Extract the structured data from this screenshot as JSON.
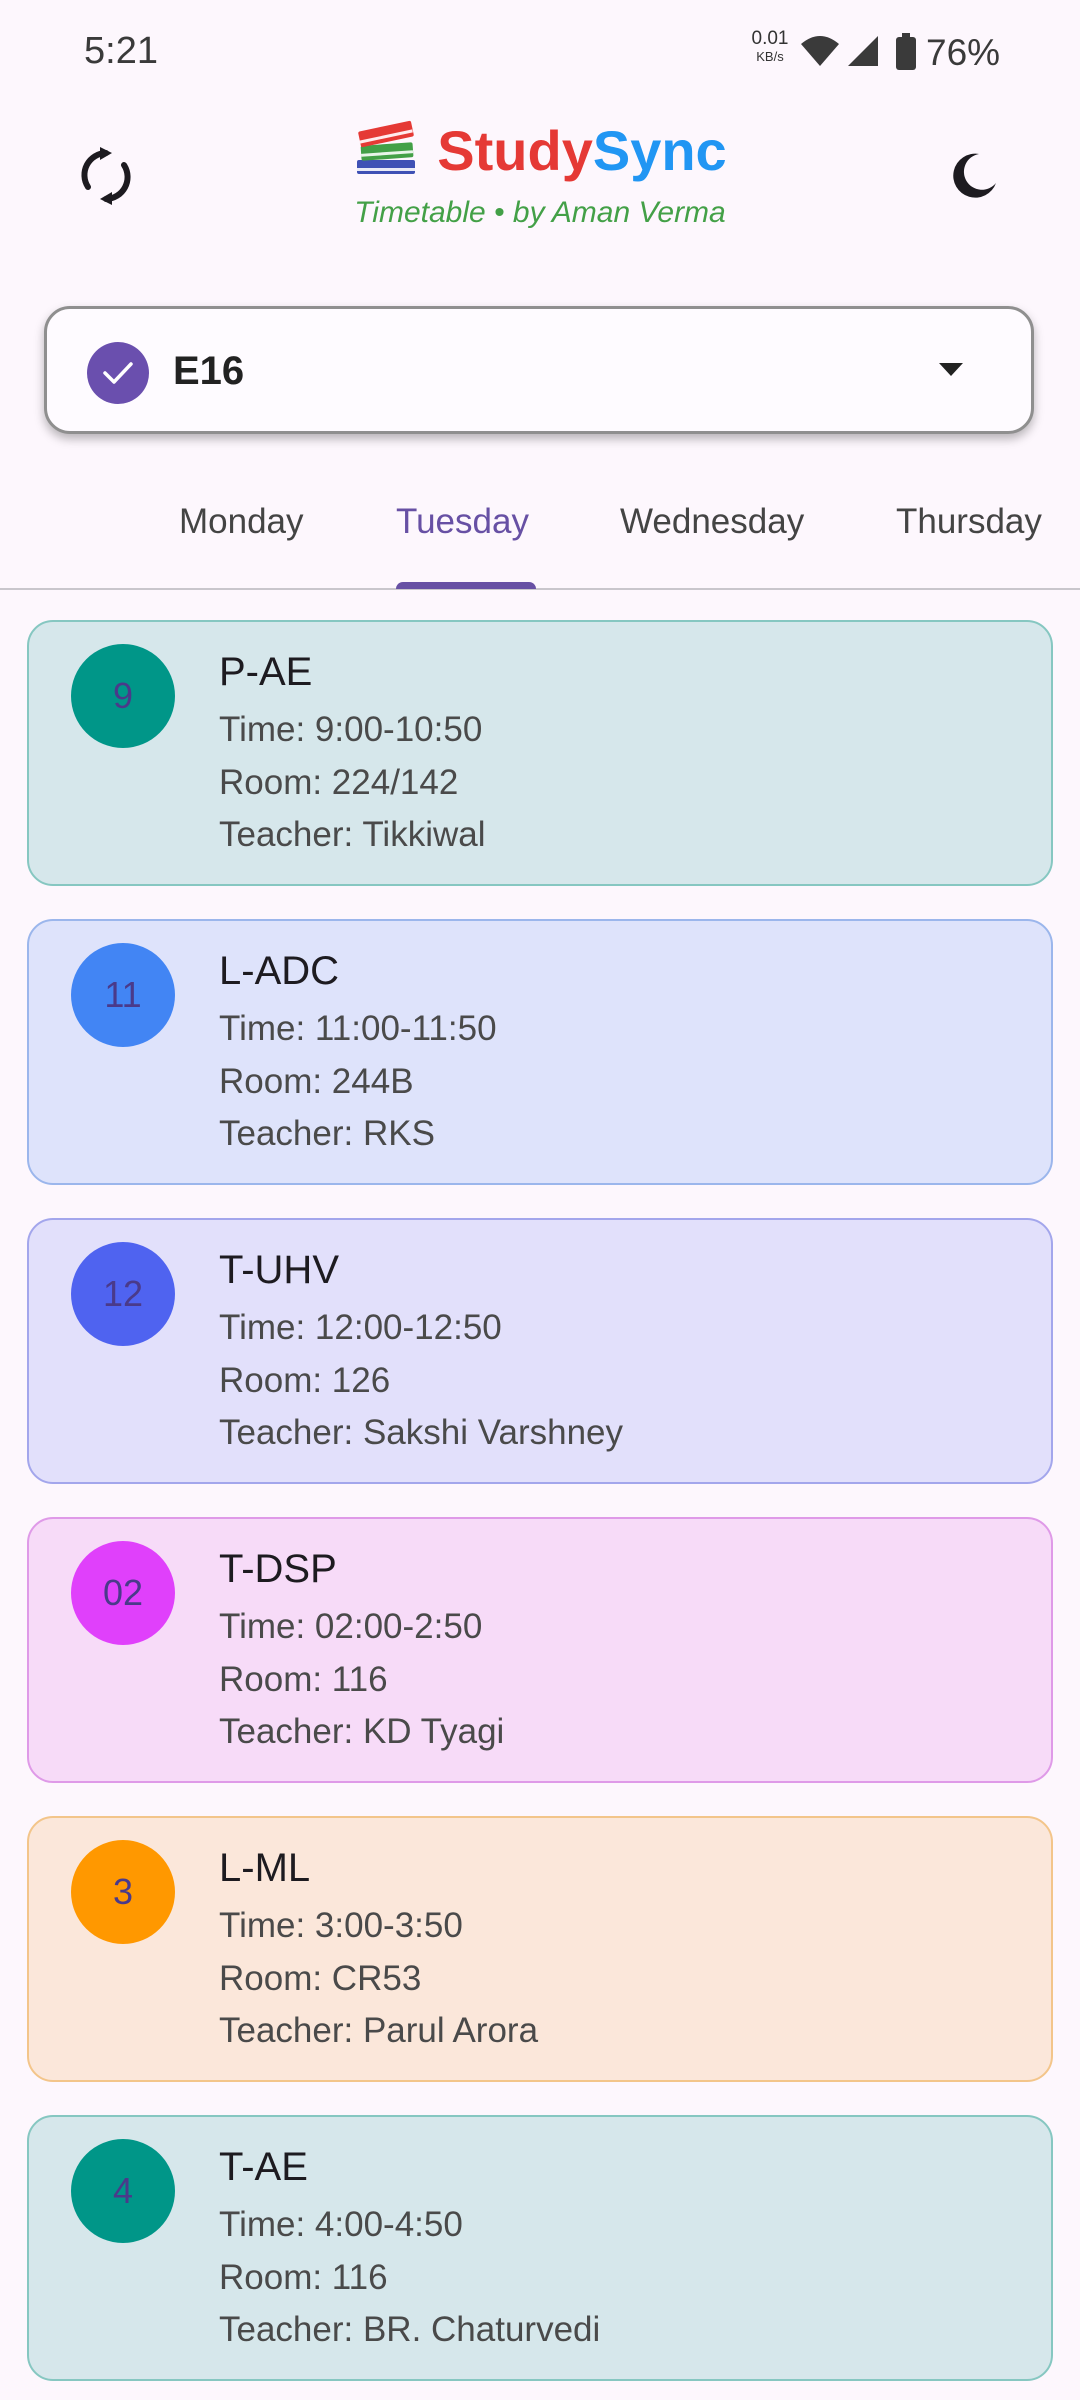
{
  "status_bar": {
    "time": "5:21",
    "net_speed_value": "0.01",
    "net_speed_unit": "KB/s",
    "battery": "76%",
    "icons": [
      "wifi-icon",
      "signal-icon",
      "battery-icon"
    ]
  },
  "header": {
    "brand_part1": "StudySync",
    "brand_study": "Study",
    "brand_sync": "Sync",
    "subtitle": "Timetable • by Aman Verma",
    "left_icon": "sync-icon",
    "right_icon": "moon-icon",
    "colors": {
      "study": "#e53935",
      "sync": "#2196f3",
      "subtitle": "#43a047"
    }
  },
  "group_select": {
    "value": "E16",
    "icon": "check-icon"
  },
  "tabs": {
    "items": [
      "Monday",
      "Tuesday",
      "Wednesday",
      "Thursday"
    ],
    "active": "Tuesday",
    "accent": "#6750a4"
  },
  "classes": [
    {
      "slot": "9",
      "subject": "P-AE",
      "time": "Time: 9:00-10:50",
      "room": "Room: 224/142",
      "teacher": "Teacher: Tikkiwal",
      "bg": "#d6e7eb",
      "border": "#86c7c1",
      "circle": "#009688"
    },
    {
      "slot": "11",
      "subject": "L-ADC",
      "time": "Time: 11:00-11:50",
      "room": "Room: 244B",
      "teacher": "Teacher: RKS",
      "bg": "#dee3fb",
      "border": "#9bb6ec",
      "circle": "#4285f4"
    },
    {
      "slot": "12",
      "subject": "T-UHV",
      "time": "Time: 12:00-12:50",
      "room": "Room: 126",
      "teacher": "Teacher: Sakshi Varshney",
      "bg": "#e2e0fb",
      "border": "#a3a6ec",
      "circle": "#4f63f0"
    },
    {
      "slot": "02",
      "subject": "T-DSP",
      "time": "Time: 02:00-2:50",
      "room": "Room: 116",
      "teacher": "Teacher: KD Tyagi",
      "bg": "#f7dbf8",
      "border": "#df9ae8",
      "circle": "#e040fb"
    },
    {
      "slot": "3",
      "subject": "L-ML",
      "time": "Time: 3:00-3:50",
      "room": "Room: CR53",
      "teacher": "Teacher: Parul Arora",
      "bg": "#fbe7da",
      "border": "#f3c58a",
      "circle": "#ff9800"
    },
    {
      "slot": "4",
      "subject": "T-AE",
      "time": "Time: 4:00-4:50",
      "room": "Room: 116",
      "teacher": "Teacher: BR. Chaturvedi",
      "bg": "#d6e7eb",
      "border": "#86c7c1",
      "circle": "#009688"
    }
  ]
}
